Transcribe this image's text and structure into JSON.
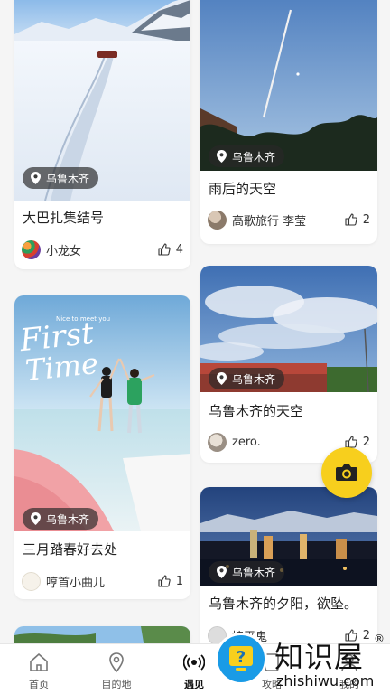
{
  "feed": {
    "left_column": [
      {
        "location": "乌鲁木齐",
        "title": "大巴扎集结号",
        "author": "小龙女",
        "likes": "4"
      },
      {
        "location": "乌鲁木齐",
        "title": "三月踏春好去处",
        "author": "哼首小曲儿",
        "likes": "1",
        "photo_text": {
          "small": "Nice to meet you",
          "big1": "First",
          "big2": "Time"
        }
      }
    ],
    "right_column": [
      {
        "location": "乌鲁木齐",
        "title": "雨后的天空",
        "author": "高歌旅行 李莹",
        "likes": "2"
      },
      {
        "location": "乌鲁木齐",
        "title": "乌鲁木齐的天空",
        "author": "zero.",
        "likes": "2"
      },
      {
        "location": "乌鲁木齐",
        "title": "乌鲁木齐的夕阳，欲坠。",
        "author": "接平鬼",
        "likes": "2"
      }
    ]
  },
  "tabbar": {
    "tabs": [
      {
        "label": "首页",
        "icon": "home-icon"
      },
      {
        "label": "目的地",
        "icon": "location-pin-icon"
      },
      {
        "label": "遇见",
        "icon": "broadcast-icon",
        "active": true
      },
      {
        "label": "攻略",
        "icon": "guide-icon"
      },
      {
        "label": "我的",
        "icon": "profile-icon"
      }
    ]
  },
  "fab": {
    "icon": "camera-icon",
    "color": "#f7cf1d"
  },
  "watermark": {
    "cn": "知识屋",
    "en": "zhishiwu.com",
    "reg": "®"
  },
  "colors": {
    "accent": "#f7cf1d",
    "location_tag_bg": "#282828",
    "watermark_blue": "#1a9be6"
  }
}
